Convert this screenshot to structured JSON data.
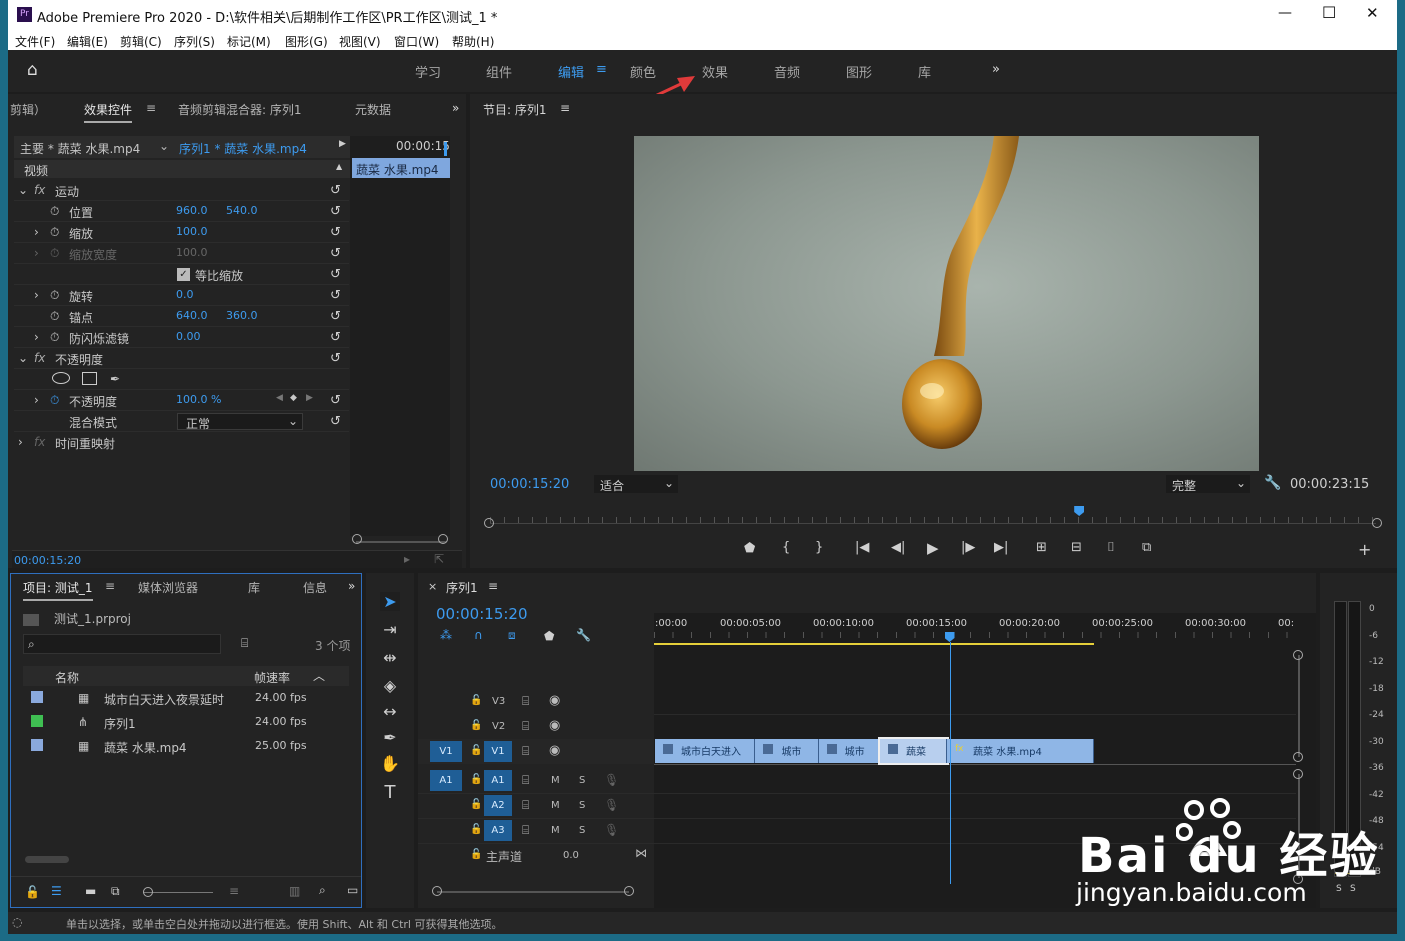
{
  "window": {
    "title": "Adobe Premiere Pro 2020 - D:\\软件相关\\后期制作工作区\\PR工作区\\测试_1 *",
    "app_icon": "Pr",
    "controls": [
      "—",
      "☐",
      "✕"
    ]
  },
  "menu": [
    "文件(F)",
    "编辑(E)",
    "剪辑(C)",
    "序列(S)",
    "标记(M)",
    "图形(G)",
    "视图(V)",
    "窗口(W)",
    "帮助(H)"
  ],
  "workspaces": [
    "学习",
    "组件",
    "编辑",
    "颜色",
    "效果",
    "音频",
    "图形",
    "库"
  ],
  "workspace_active": "编辑",
  "effect_controls": {
    "tabs": [
      "剪辑）",
      "效果控件",
      "音频剪辑混合器: 序列1",
      "元数据"
    ],
    "source_label": "主要 * 蔬菜 水果.mp4",
    "sequence_label": "序列1 * 蔬菜 水果.mp4",
    "timecode_mini": "00:00:15",
    "mini_clip": "蔬菜 水果.mp4",
    "section_video": "视频",
    "motion": "运动",
    "props": [
      {
        "name": "位置",
        "v1": "960.0",
        "v2": "540.0"
      },
      {
        "name": "缩放",
        "v1": "100.0",
        "v2": ""
      },
      {
        "name": "缩放宽度",
        "v1": "100.0",
        "v2": ""
      },
      {
        "name": "等比缩放",
        "v1": "",
        "v2": ""
      },
      {
        "name": "旋转",
        "v1": "0.0",
        "v2": ""
      },
      {
        "name": "锚点",
        "v1": "640.0",
        "v2": "360.0"
      },
      {
        "name": "防闪烁滤镜",
        "v1": "0.00",
        "v2": ""
      }
    ],
    "opacity_section": "不透明度",
    "opacity_label": "不透明度",
    "opacity_value": "100.0 %",
    "blend_label": "混合模式",
    "blend_value": "正常",
    "time_remap": "时间重映射",
    "timecode": "00:00:15:20"
  },
  "program": {
    "title": "节目: 序列1",
    "timecode": "00:00:15:20",
    "fit": "适合",
    "quality": "完整",
    "duration": "00:00:23:15",
    "playhead_fraction": 0.665
  },
  "project": {
    "tabs": [
      "项目: 测试_1",
      "媒体浏览器",
      "库",
      "信息"
    ],
    "file": "测试_1.prproj",
    "count": "3 个项",
    "search_placeholder": "",
    "col_name": "名称",
    "col_fps": "帧速率",
    "items": [
      {
        "name": "城市白天进入夜景延时",
        "fps": "24.00 fps",
        "color": "#8aa9dc"
      },
      {
        "name": "序列1",
        "fps": "24.00 fps",
        "color": "#3fbf52"
      },
      {
        "name": "蔬菜 水果.mp4",
        "fps": "25.00 fps",
        "color": "#8aa9dc"
      }
    ]
  },
  "timeline": {
    "title": "序列1",
    "timecode": "00:00:15:20",
    "ruler": [
      ":00:00",
      "00:00:05:00",
      "00:00:10:00",
      "00:00:15:00",
      "00:00:20:00",
      "00:00:25:00",
      "00:00:30:00",
      "00:"
    ],
    "video_tracks": [
      "V3",
      "V2",
      "V1"
    ],
    "audio_tracks": [
      "A1",
      "A2",
      "A3"
    ],
    "source_v": "V1",
    "source_a": "A1",
    "master_label": "主声道",
    "master_value": "0.0",
    "m": "M",
    "s": "S",
    "clips": [
      {
        "label": "城市白天进入",
        "start_sec": 0,
        "end_sec": 5.4
      },
      {
        "label": "城市",
        "start_sec": 5.4,
        "end_sec": 8.8
      },
      {
        "label": "城市",
        "start_sec": 8.8,
        "end_sec": 12.1
      },
      {
        "label": "蔬菜",
        "start_sec": 12.1,
        "end_sec": 15.7
      },
      {
        "label": "蔬菜 水果.mp4",
        "start_sec": 15.7,
        "end_sec": 23.6
      }
    ]
  },
  "meter": {
    "labels": [
      "0",
      "-6",
      "-12",
      "-18",
      "-24",
      "-30",
      "-36",
      "-42",
      "-48",
      "-54",
      "dB"
    ],
    "solo": [
      "S",
      "S"
    ]
  },
  "status": "单击以选择，或单击空白处并拖动以进行框选。使用 Shift、Alt 和 Ctrl 可获得其他选项。",
  "watermark": {
    "brand": "Bai du 经验",
    "url": "jingyan.baidu.com"
  }
}
